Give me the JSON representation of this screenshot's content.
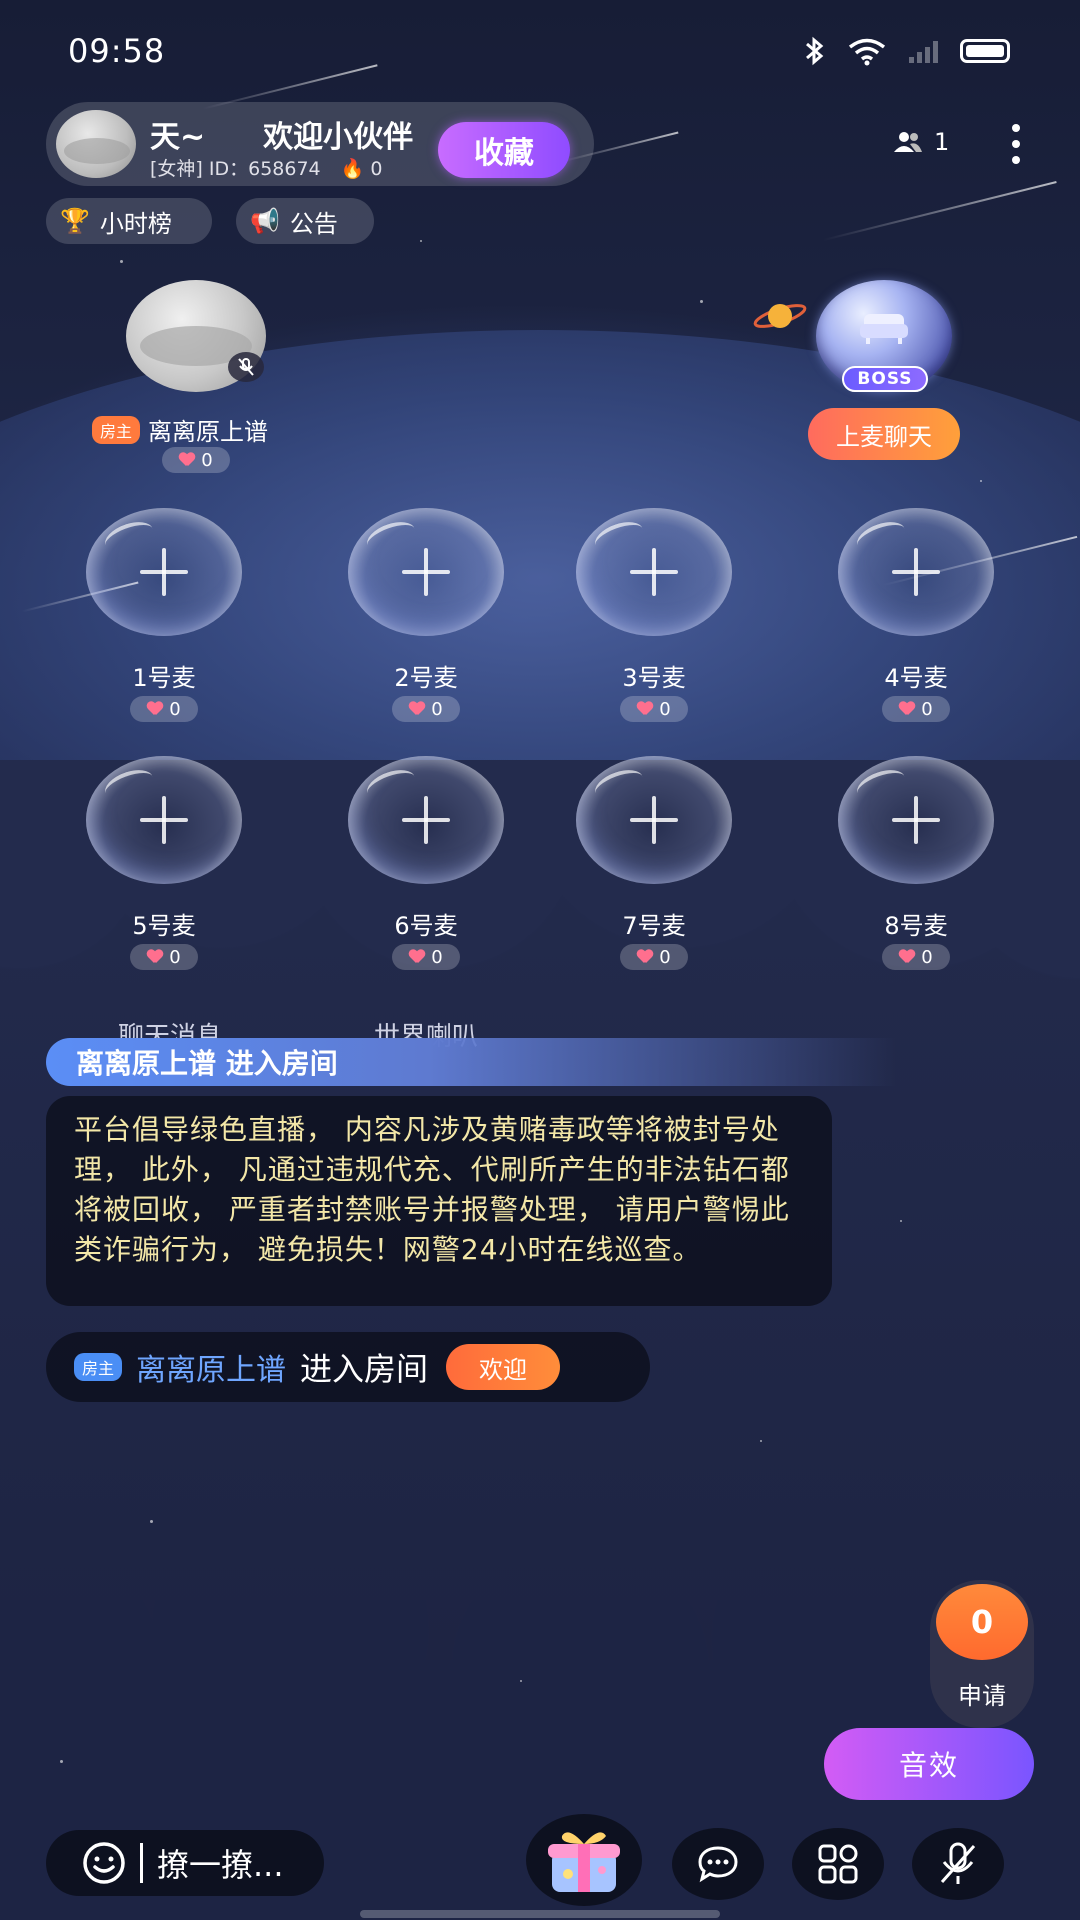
{
  "status_bar": {
    "time": "09:58",
    "icons": [
      "bluetooth-icon",
      "wifi-icon",
      "signal-icon",
      "battery-icon"
    ]
  },
  "room": {
    "title": "天~",
    "title_marquee": "欢迎小伙伴",
    "badge": "[女神]",
    "id_label": "ID：658674",
    "heat": "0",
    "favorite_label": "收藏",
    "online_count": "1"
  },
  "chips": {
    "rank": "小时榜",
    "notice": "公告"
  },
  "host": {
    "owner_tag": "房主",
    "name": "离离原上谱",
    "likes": "0"
  },
  "boss": {
    "badge": "BOSS",
    "join_label": "上麦聊天"
  },
  "seats": [
    {
      "label": "1号麦",
      "likes": "0"
    },
    {
      "label": "2号麦",
      "likes": "0"
    },
    {
      "label": "3号麦",
      "likes": "0"
    },
    {
      "label": "4号麦",
      "likes": "0"
    },
    {
      "label": "5号麦",
      "likes": "0"
    },
    {
      "label": "6号麦",
      "likes": "0"
    },
    {
      "label": "7号麦",
      "likes": "0"
    },
    {
      "label": "8号麦",
      "likes": "0"
    }
  ],
  "chat": {
    "tabs": [
      "聊天消息",
      "世界喇叭"
    ],
    "enter_banner": "离离原上谱 进入房间",
    "notice": "平台倡导绿色直播， 内容凡涉及黄赌毒政等将被封号处理， 此外， 凡通过违规代充、代刷所产生的非法钻石都将被回收， 严重者封禁账号并报警处理， 请用户警惕此类诈骗行为， 避免损失！网警24小时在线巡查。",
    "enter_msg": {
      "tag": "房主",
      "name": "离离原上谱",
      "action": "进入房间",
      "welcome_label": "欢迎"
    }
  },
  "apply": {
    "count": "0",
    "label": "申请"
  },
  "sound_label": "音效",
  "bottom": {
    "input_placeholder": "撩一撩..."
  },
  "colors": {
    "accent_purple": "#9a55ff",
    "accent_orange": "#ff7a3d",
    "notice_text": "#f3e7a8",
    "link_blue": "#6fa6ff"
  }
}
